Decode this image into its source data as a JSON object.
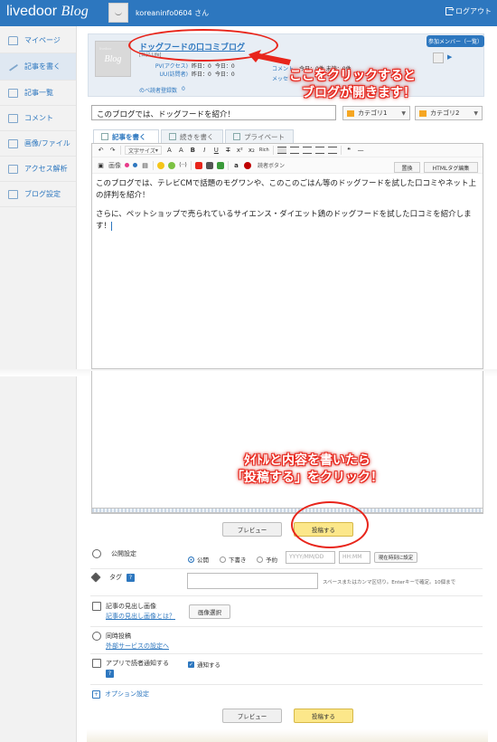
{
  "header": {
    "brand": "livedoor",
    "brand_blog": "Blog",
    "user": "koreaninfo0604 さん",
    "logout": "ログアウト"
  },
  "sidebar": {
    "items": [
      {
        "label": "マイページ",
        "icon": "home-icon"
      },
      {
        "label": "記事を書く",
        "icon": "pen-icon",
        "active": true
      },
      {
        "label": "記事一覧",
        "icon": "list-icon"
      },
      {
        "label": "コメント",
        "icon": "comment-icon"
      },
      {
        "label": "画像/ファイル",
        "icon": "image-icon"
      },
      {
        "label": "アクセス解析",
        "icon": "chart-icon"
      },
      {
        "label": "ブログ設定",
        "icon": "wrench-icon"
      }
    ]
  },
  "blog": {
    "thumb_small": "livedoor",
    "thumb_big": "Blog",
    "title": "ドッグフードの口コミブログ",
    "subtitle": "[日記·Life]",
    "stats": [
      {
        "label": "PV(アクセス)",
        "yesterday": "昨日：0",
        "today": "今日：0"
      },
      {
        "label": "UU(訪問者)",
        "yesterday": "昨日：0",
        "today": "今日：0"
      }
    ],
    "readers_label": "のべ読者登録数",
    "readers_value": "0",
    "comment_label": "コメント",
    "comment_today": "今日：0件",
    "comment_unread": "未読：0件",
    "message_label": "メッセ",
    "member_button": "参加メンバー（一覧）"
  },
  "annotations": {
    "callout1_line1": "ここをクリックすると",
    "callout1_line2": "ブログが開きます！",
    "callout2_line1": "ﾀｲﾄﾙと内容を書いたら",
    "callout2_line2": "「投稿する」をクリック！",
    "accent": "#e8251b"
  },
  "editor": {
    "title_value": "このブログでは、ドッグフードを紹介！",
    "category1": "カテゴリ1",
    "category2": "カテゴリ2",
    "tabs": [
      "記事を書く",
      "続きを書く",
      "プライベート"
    ],
    "toolbar": {
      "font_size": "文字サイズ",
      "image": "画像",
      "reader_button": "読者ボタン",
      "replace": "置換",
      "html_edit": "HTMLタグ編集",
      "rich": "Rich"
    },
    "body": [
      "このブログでは、テレビCMで話題のモグワンや、このこのごはん等のドッグフードを試した口コミやネット上の評判を紹介！",
      "さらに、ペットショップで売られているサイエンス・ダイエット鶏のドッグフードを試した口コミを紹介します！"
    ]
  },
  "actions": {
    "preview": "プレビュー",
    "post": "投稿する"
  },
  "settings": {
    "publish_label": "公開設定",
    "publish_options": [
      "公開",
      "下書き",
      "予約"
    ],
    "date_placeholder": "YYYY/MM/DD",
    "time_placeholder": "HH:MM",
    "now_button": "現在時刻に設定",
    "tag_label": "タグ",
    "tag_hint": "スペースまたはカンマ区切り。Enterキーで確定。10個まで",
    "heading_image_label": "記事の見出し画像",
    "heading_image_link": "記事の見出し画像とは？",
    "image_select": "画像選択",
    "sync_label": "同時投稿",
    "sync_link": "外部サービスの設定へ",
    "app_notify_label": "アプリで読者通知する",
    "notify_check": "通知する",
    "option_label": "オプション設定"
  }
}
